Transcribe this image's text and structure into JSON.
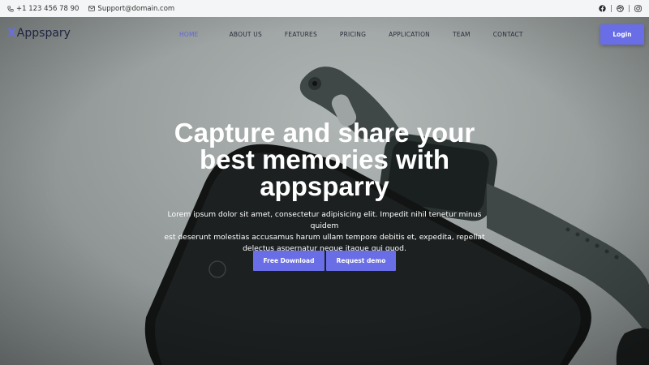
{
  "topbar": {
    "phone": "+1 123 456 78 90",
    "email": "Support@domain.com",
    "social": [
      "facebook-icon",
      "dribbble-icon",
      "instagram-icon"
    ],
    "separator": "|"
  },
  "brand": {
    "mark": "X",
    "name": "Appspary"
  },
  "nav": {
    "items": [
      {
        "label": "HOME",
        "active": true
      },
      {
        "label": "ABOUT US",
        "active": false
      },
      {
        "label": "FEATURES",
        "active": false
      },
      {
        "label": "PRICING",
        "active": false
      },
      {
        "label": "APPLICATION",
        "active": false
      },
      {
        "label": "TEAM",
        "active": false
      },
      {
        "label": "CONTACT",
        "active": false
      }
    ],
    "login_label": "Login"
  },
  "hero": {
    "headline_line1": "Capture and share your",
    "headline_line2": "best memories with",
    "headline_line3": "appsparry",
    "subtext_line1": "Lorem ipsum dolor sit amet, consectetur adipisicing elit. Impedit nihil tenetur minus quidem",
    "subtext_line2": "est deserunt molestias accusamus harum ullam tempore debitis et, expedita, repellat",
    "subtext_line3": "delectus aspernatur neque itaque qui quod.",
    "primary_cta": "Free Download",
    "secondary_cta": "Request demo"
  },
  "colors": {
    "accent": "#6a6ee6",
    "nav_active": "#6266d9",
    "topbar_bg": "#f4f5f6"
  }
}
